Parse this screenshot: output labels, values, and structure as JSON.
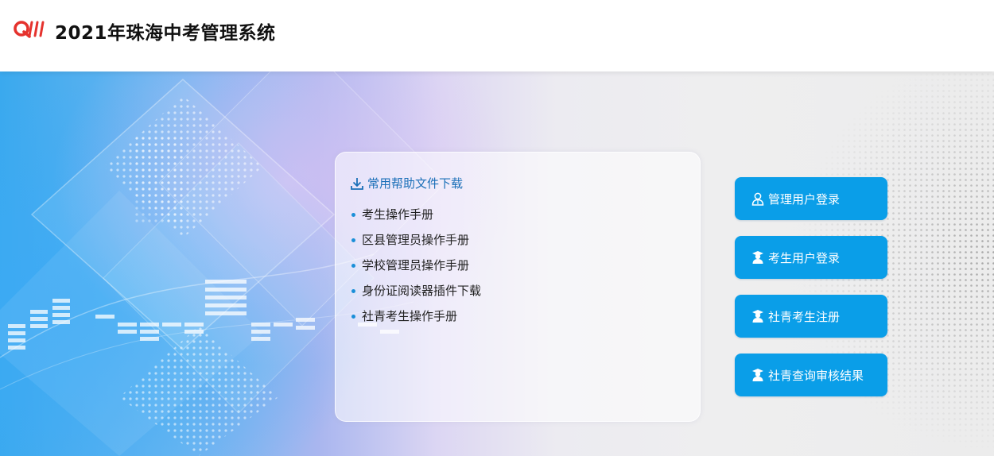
{
  "header": {
    "title": "2021年珠海中考管理系统",
    "logo_icon": "qw-logo-icon",
    "logo_color": "#e5322d"
  },
  "help": {
    "title": "常用帮助文件下载",
    "title_icon": "download-icon",
    "title_color": "#1a6fb8",
    "documents": [
      {
        "label": "考生操作手册"
      },
      {
        "label": "区县管理员操作手册"
      },
      {
        "label": "学校管理员操作手册"
      },
      {
        "label": "身份证阅读器插件下载"
      },
      {
        "label": "社青考生操作手册"
      }
    ]
  },
  "actions": {
    "button_color": "#0a9ee8",
    "buttons": [
      {
        "label": "管理用户登录",
        "icon": "admin-user-icon"
      },
      {
        "label": "考生用户登录",
        "icon": "student-user-icon"
      },
      {
        "label": "社青考生注册",
        "icon": "student-user-icon"
      },
      {
        "label": "社青查询审核结果",
        "icon": "student-user-icon"
      }
    ]
  }
}
